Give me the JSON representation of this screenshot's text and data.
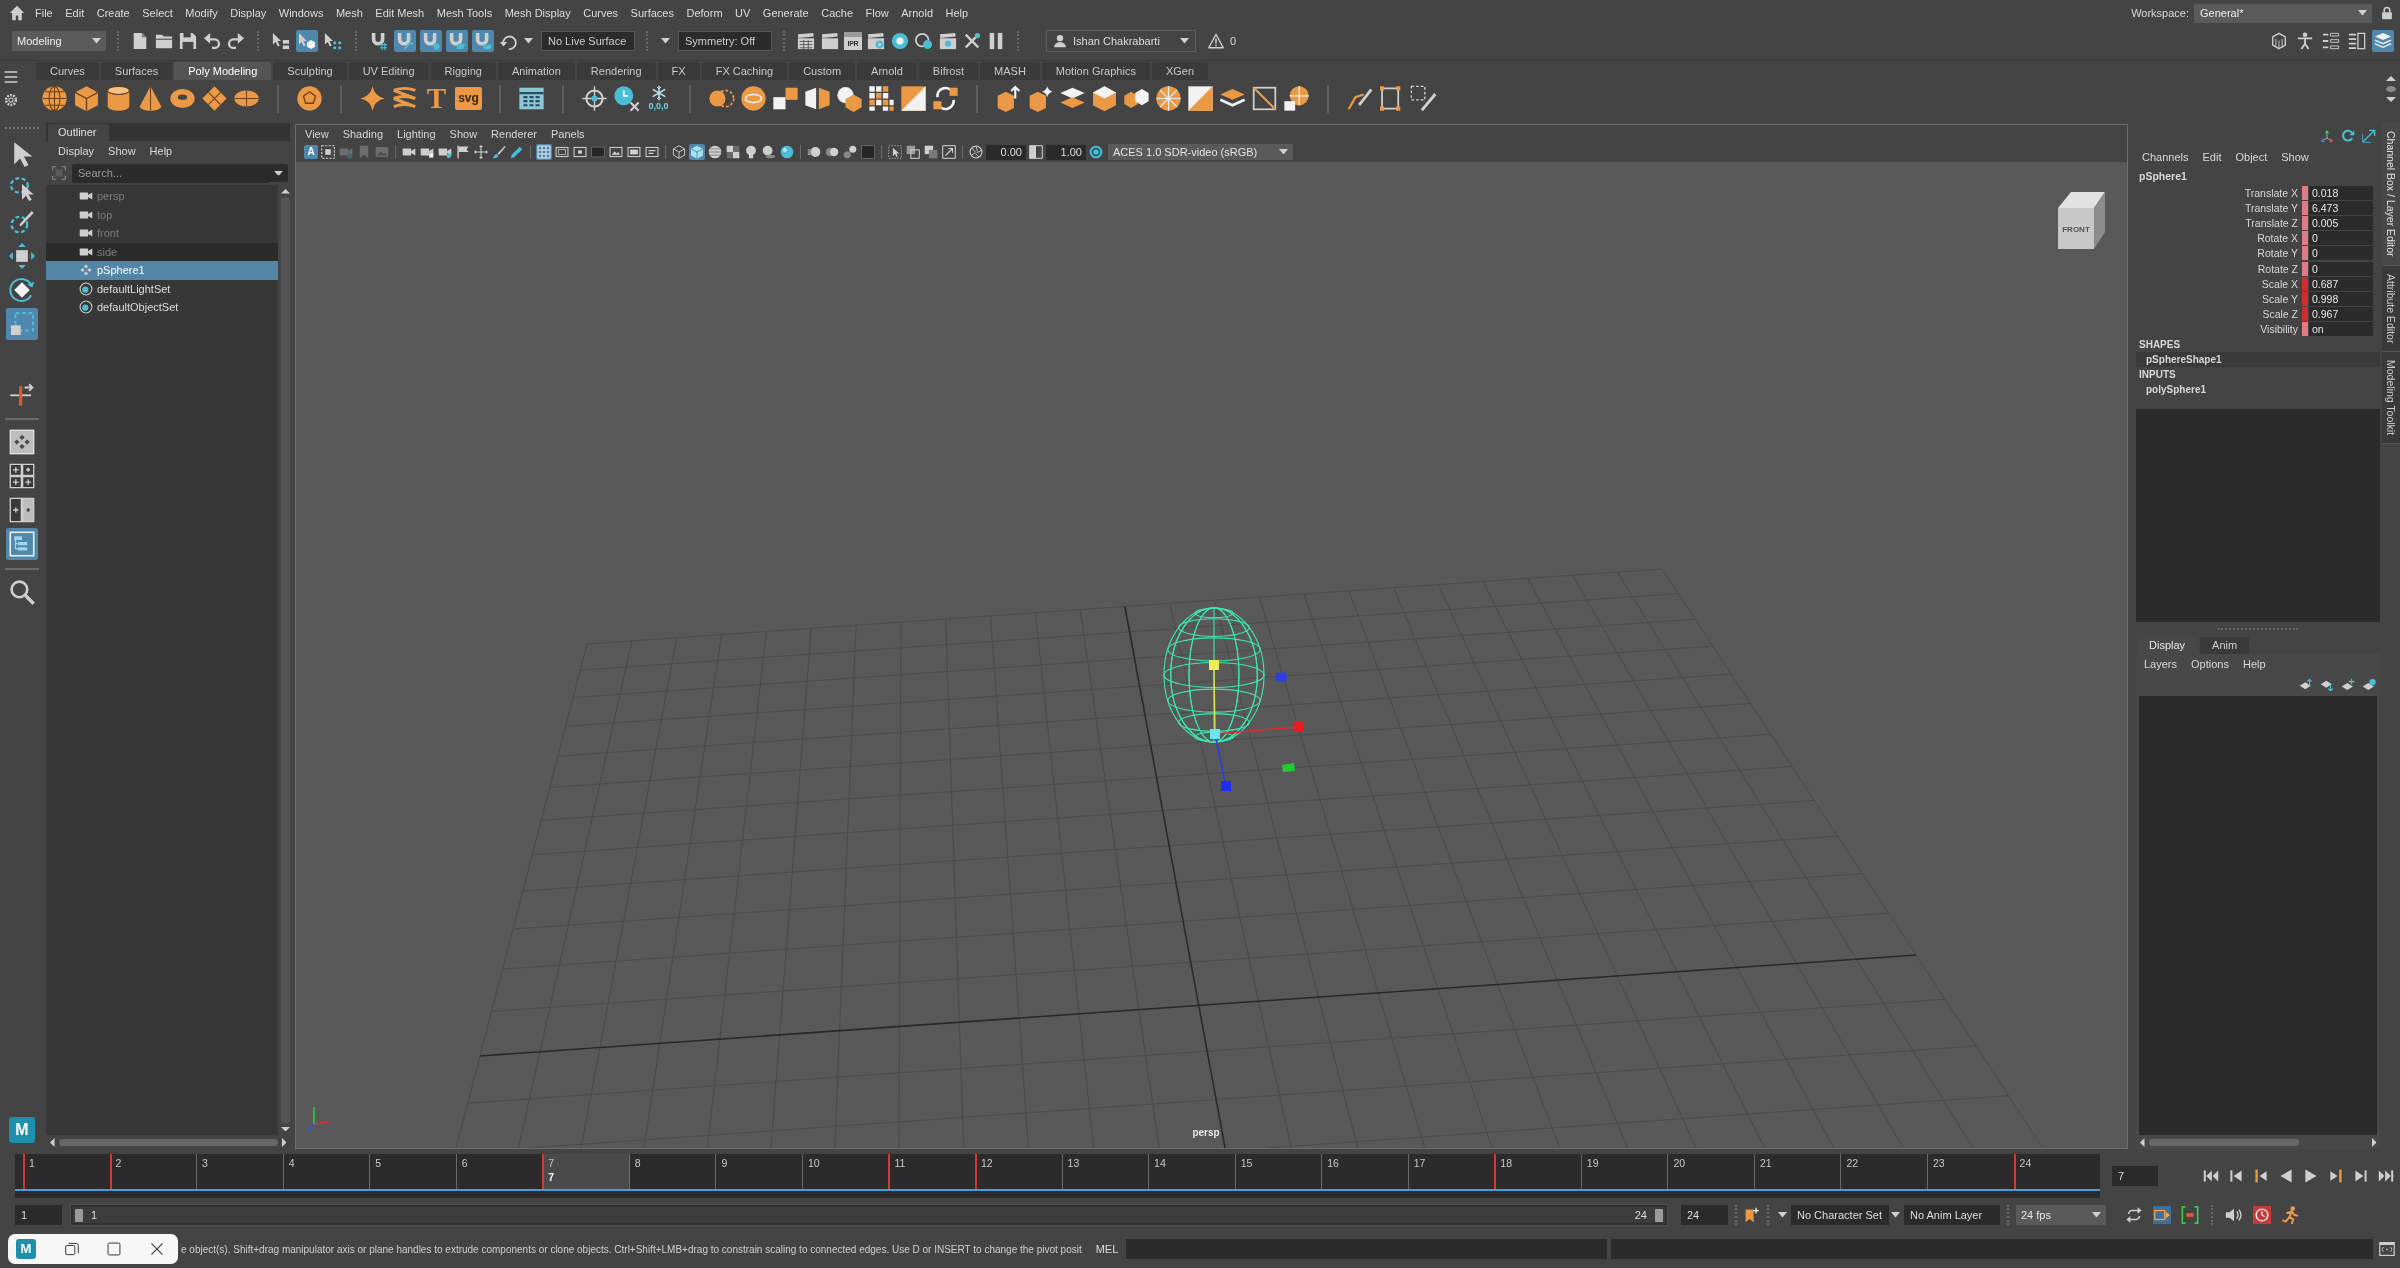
{
  "menu_bar": {
    "items": [
      "File",
      "Edit",
      "Create",
      "Select",
      "Modify",
      "Display",
      "Windows",
      "Mesh",
      "Edit Mesh",
      "Mesh Tools",
      "Mesh Display",
      "Curves",
      "Surfaces",
      "Deform",
      "UV",
      "Generate",
      "Cache",
      "Flow",
      "Arnold",
      "Help"
    ],
    "workspace_label": "Workspace:",
    "workspace": "General*"
  },
  "status_line": {
    "menu_set": "Modeling",
    "selection_modes": [
      {
        "kind": "hierarchy",
        "selected": false
      },
      {
        "kind": "object",
        "selected": true
      },
      {
        "kind": "component",
        "selected": false
      }
    ],
    "snap_buttons": [
      {
        "kind": "grid",
        "on": false
      },
      {
        "kind": "curve",
        "on": true
      },
      {
        "kind": "point",
        "on": true
      },
      {
        "kind": "view_plane",
        "on": true
      },
      {
        "kind": "surface",
        "on": true
      }
    ],
    "live_surface": "No Live Surface",
    "symmetry": "Symmetry: Off",
    "ipr_label": "IPR",
    "user": "Ishan Chakrabarti",
    "warning_count": "0",
    "panel_toggles": [
      {
        "kind": "modeling_toolkit",
        "on": false
      },
      {
        "kind": "character",
        "on": false
      },
      {
        "kind": "attribute_editor",
        "on": false
      },
      {
        "kind": "tool_settings",
        "on": false
      },
      {
        "kind": "channel_box",
        "on": true
      }
    ]
  },
  "shelf": {
    "tabs": [
      {
        "label": "Curves",
        "selected": false
      },
      {
        "label": "Surfaces",
        "selected": false
      },
      {
        "label": "Poly Modeling",
        "selected": true
      },
      {
        "label": "Sculpting",
        "selected": false
      },
      {
        "label": "UV Editing",
        "selected": false
      },
      {
        "label": "Rigging",
        "selected": false
      },
      {
        "label": "Animation",
        "selected": false
      },
      {
        "label": "Rendering",
        "selected": false
      },
      {
        "label": "FX",
        "selected": false
      },
      {
        "label": "FX Caching",
        "selected": false
      },
      {
        "label": "Custom",
        "selected": false
      },
      {
        "label": "Arnold",
        "selected": false
      },
      {
        "label": "Bifrost",
        "selected": false
      },
      {
        "label": "MASH",
        "selected": false
      },
      {
        "label": "Motion Graphics",
        "selected": false
      },
      {
        "label": "XGen",
        "selected": false
      }
    ],
    "button_texts": [
      "T",
      "svg",
      "0,0,0"
    ]
  },
  "toolbox": {
    "tools": [
      {
        "kind": "select",
        "selected": false
      },
      {
        "kind": "lasso",
        "selected": false
      },
      {
        "kind": "paint_select",
        "selected": false
      },
      {
        "kind": "move",
        "selected": false
      },
      {
        "kind": "rotate",
        "selected": false
      },
      {
        "kind": "scale",
        "selected": true
      },
      {
        "kind": "last_tool",
        "selected": false
      }
    ],
    "layouts": [
      {
        "kind": "single",
        "selected": false
      },
      {
        "kind": "four",
        "selected": false
      },
      {
        "kind": "two",
        "selected": false
      },
      {
        "kind": "outliner",
        "selected": true
      }
    ],
    "logo_text": "M"
  },
  "outliner": {
    "tab": "Outliner",
    "menus": [
      "Display",
      "Show",
      "Help"
    ],
    "search_placeholder": "Search...",
    "items": [
      {
        "name": "persp",
        "kind": "camera",
        "hidden": true,
        "hovered": false,
        "selected": false
      },
      {
        "name": "top",
        "kind": "camera",
        "hidden": true,
        "hovered": false,
        "selected": false
      },
      {
        "name": "front",
        "kind": "camera",
        "hidden": true,
        "hovered": false,
        "selected": false
      },
      {
        "name": "side",
        "kind": "camera",
        "hidden": true,
        "hovered": true,
        "selected": false
      },
      {
        "name": "pSphere1",
        "kind": "mesh",
        "hidden": false,
        "hovered": false,
        "selected": true
      },
      {
        "name": "defaultLightSet",
        "kind": "set",
        "hidden": false,
        "hovered": false,
        "selected": false
      },
      {
        "name": "defaultObjectSet",
        "kind": "set",
        "hidden": false,
        "hovered": false,
        "selected": false
      }
    ]
  },
  "viewport": {
    "menus": [
      "View",
      "Shading",
      "Lighting",
      "Show",
      "Renderer",
      "Panels"
    ],
    "toolbar_groups": [
      [
        {
          "kind": "camera_attributes",
          "text": "A",
          "on": true,
          "disabled": false
        },
        {
          "kind": "select_camera",
          "on": false,
          "disabled": false
        },
        {
          "kind": "lock_camera",
          "on": false,
          "disabled": true
        },
        {
          "kind": "bookmark",
          "on": false,
          "disabled": true
        },
        {
          "kind": "image_plane",
          "on": false,
          "disabled": true
        }
      ],
      [
        {
          "kind": "camera",
          "on": false,
          "disabled": false
        },
        {
          "kind": "camera_lock",
          "on": false,
          "disabled": false
        },
        {
          "kind": "camera_key",
          "on": false,
          "disabled": false
        },
        {
          "kind": "flag",
          "on": false,
          "disabled": false
        },
        {
          "kind": "pan",
          "on": false,
          "disabled": false
        },
        {
          "kind": "brush",
          "on": false,
          "disabled": false
        },
        {
          "kind": "grease_pencil",
          "on": false,
          "disabled": false
        }
      ],
      [
        {
          "kind": "grid",
          "on": true,
          "disabled": false
        },
        {
          "kind": "film_gate",
          "on": false,
          "disabled": false
        },
        {
          "kind": "resolution_gate",
          "on": false,
          "disabled": false
        },
        {
          "kind": "gate_mask",
          "on": false,
          "disabled": false
        },
        {
          "kind": "field_chart",
          "on": false,
          "disabled": false
        },
        {
          "kind": "safe_action",
          "on": false,
          "disabled": false
        },
        {
          "kind": "safe_title",
          "on": false,
          "disabled": false
        }
      ],
      [
        {
          "kind": "wireframe",
          "on": false,
          "disabled": false
        },
        {
          "kind": "smooth_shade",
          "on": true,
          "disabled": false
        },
        {
          "kind": "default_material",
          "on": false,
          "disabled": false
        },
        {
          "kind": "textured",
          "on": false,
          "disabled": false
        },
        {
          "kind": "lights",
          "on": false,
          "disabled": false
        },
        {
          "kind": "shadows",
          "on": false,
          "disabled": false
        },
        {
          "kind": "ambient_occlusion",
          "on": false,
          "disabled": false
        }
      ],
      [
        {
          "kind": "motion_blur",
          "on": false,
          "disabled": false
        },
        {
          "kind": "anti_alias",
          "on": false,
          "disabled": false
        },
        {
          "kind": "depth_of_field",
          "on": false,
          "disabled": false
        },
        {
          "kind": "hud",
          "on": false,
          "disabled": false
        }
      ],
      [
        {
          "kind": "isolate",
          "on": false,
          "disabled": false
        },
        {
          "kind": "xray",
          "on": false,
          "disabled": false
        },
        {
          "kind": "xray_joints",
          "on": false,
          "disabled": false
        },
        {
          "kind": "xray_components",
          "on": false,
          "disabled": false
        }
      ]
    ],
    "exposure": "0.00",
    "gamma": "1.00",
    "color_space": "ACES 1.0 SDR-video (sRGB)",
    "view_cube_label": "FRONT",
    "camera_label": "persp"
  },
  "channel_box": {
    "menus": [
      "Channels",
      "Edit",
      "Object",
      "Show"
    ],
    "object": "pSphere1",
    "channels": [
      {
        "name": "Translate X",
        "value": "0.018",
        "color": "#e07b85"
      },
      {
        "name": "Translate Y",
        "value": "6.473",
        "color": "#e07b85"
      },
      {
        "name": "Translate Z",
        "value": "0.005",
        "color": "#e07b85"
      },
      {
        "name": "Rotate X",
        "value": "0",
        "color": "#e07b85"
      },
      {
        "name": "Rotate Y",
        "value": "0",
        "color": "#e07b85"
      },
      {
        "name": "Rotate Z",
        "value": "0",
        "color": "#e07b85"
      },
      {
        "name": "Scale X",
        "value": "0.687",
        "color": "#d12c2c"
      },
      {
        "name": "Scale Y",
        "value": "0.998",
        "color": "#d12c2c"
      },
      {
        "name": "Scale Z",
        "value": "0.967",
        "color": "#d12c2c"
      },
      {
        "name": "Visibility",
        "value": "on",
        "color": "#e07b85"
      }
    ],
    "shapes_heading": "SHAPES",
    "shapes": [
      "pSphereShape1"
    ],
    "inputs_heading": "INPUTS",
    "inputs": [
      "polySphere1"
    ]
  },
  "layer_editor": {
    "tabs": [
      {
        "label": "Display",
        "selected": true
      },
      {
        "label": "Anim",
        "selected": false
      }
    ],
    "menus": [
      "Layers",
      "Options",
      "Help"
    ]
  },
  "side_tabs": [
    {
      "label": "Channel Box / Layer Editor",
      "selected": true
    },
    {
      "label": "Attribute Editor",
      "selected": false
    },
    {
      "label": "Modeling Toolkit",
      "selected": false
    }
  ],
  "time_slider": {
    "frames": [
      {
        "label": "1",
        "keyed": true,
        "selected": false
      },
      {
        "label": "2",
        "keyed": true,
        "selected": false
      },
      {
        "label": "3",
        "keyed": false,
        "selected": false
      },
      {
        "label": "4",
        "keyed": false,
        "selected": false
      },
      {
        "label": "5",
        "keyed": false,
        "selected": false
      },
      {
        "label": "6",
        "keyed": false,
        "selected": false
      },
      {
        "label": "7",
        "keyed": true,
        "selected": true
      },
      {
        "label": "8",
        "keyed": false,
        "selected": false
      },
      {
        "label": "9",
        "keyed": false,
        "selected": false
      },
      {
        "label": "10",
        "keyed": false,
        "selected": false
      },
      {
        "label": "11",
        "keyed": true,
        "selected": false
      },
      {
        "label": "12",
        "keyed": true,
        "selected": false
      },
      {
        "label": "13",
        "keyed": false,
        "selected": false
      },
      {
        "label": "14",
        "keyed": false,
        "selected": false
      },
      {
        "label": "15",
        "keyed": false,
        "selected": false
      },
      {
        "label": "16",
        "keyed": false,
        "selected": false
      },
      {
        "label": "17",
        "keyed": false,
        "selected": false
      },
      {
        "label": "18",
        "keyed": true,
        "selected": false
      },
      {
        "label": "19",
        "keyed": false,
        "selected": false
      },
      {
        "label": "20",
        "keyed": false,
        "selected": false
      },
      {
        "label": "21",
        "keyed": false,
        "selected": false
      },
      {
        "label": "22",
        "keyed": false,
        "selected": false
      },
      {
        "label": "23",
        "keyed": false,
        "selected": false
      },
      {
        "label": "24",
        "keyed": true,
        "selected": false
      }
    ],
    "current_frame": "7",
    "current_frame_field": "7"
  },
  "range_slider": {
    "animation_start": "1",
    "playback_start": "1",
    "level": 1,
    "playback_end": "24",
    "animation_end": "24",
    "character_set": "No Character Set",
    "anim_layer": "No Anim Layer",
    "fps": "24 fps"
  },
  "command_line": {
    "popup_logo_text": "M",
    "help_text": "e object(s). Shift+drag manipulator axis or plane handles to extrude components or clone objects. Ctrl+Shift+LMB+drag to constrain scaling to connected edges. Use D or INSERT to change the pivot posit",
    "language": "MEL"
  }
}
